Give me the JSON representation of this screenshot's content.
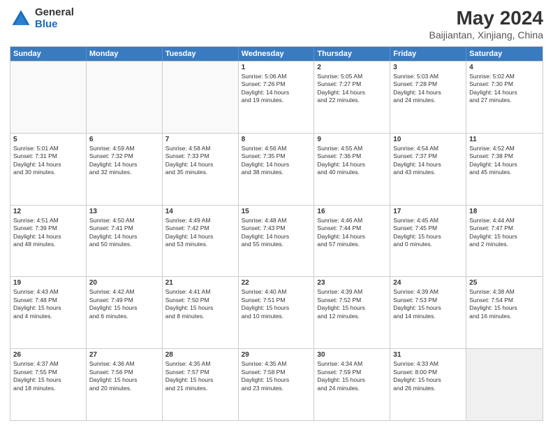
{
  "logo": {
    "general": "General",
    "blue": "Blue"
  },
  "title": "May 2024",
  "subtitle": "Baijiantan, Xinjiang, China",
  "header_days": [
    "Sunday",
    "Monday",
    "Tuesday",
    "Wednesday",
    "Thursday",
    "Friday",
    "Saturday"
  ],
  "rows": [
    [
      {
        "day": "",
        "lines": [],
        "empty": true
      },
      {
        "day": "",
        "lines": [],
        "empty": true
      },
      {
        "day": "",
        "lines": [],
        "empty": true
      },
      {
        "day": "1",
        "lines": [
          "Sunrise: 5:06 AM",
          "Sunset: 7:26 PM",
          "Daylight: 14 hours",
          "and 19 minutes."
        ]
      },
      {
        "day": "2",
        "lines": [
          "Sunrise: 5:05 AM",
          "Sunset: 7:27 PM",
          "Daylight: 14 hours",
          "and 22 minutes."
        ]
      },
      {
        "day": "3",
        "lines": [
          "Sunrise: 5:03 AM",
          "Sunset: 7:28 PM",
          "Daylight: 14 hours",
          "and 24 minutes."
        ]
      },
      {
        "day": "4",
        "lines": [
          "Sunrise: 5:02 AM",
          "Sunset: 7:30 PM",
          "Daylight: 14 hours",
          "and 27 minutes."
        ]
      }
    ],
    [
      {
        "day": "5",
        "lines": [
          "Sunrise: 5:01 AM",
          "Sunset: 7:31 PM",
          "Daylight: 14 hours",
          "and 30 minutes."
        ]
      },
      {
        "day": "6",
        "lines": [
          "Sunrise: 4:59 AM",
          "Sunset: 7:32 PM",
          "Daylight: 14 hours",
          "and 32 minutes."
        ]
      },
      {
        "day": "7",
        "lines": [
          "Sunrise: 4:58 AM",
          "Sunset: 7:33 PM",
          "Daylight: 14 hours",
          "and 35 minutes."
        ]
      },
      {
        "day": "8",
        "lines": [
          "Sunrise: 4:56 AM",
          "Sunset: 7:35 PM",
          "Daylight: 14 hours",
          "and 38 minutes."
        ]
      },
      {
        "day": "9",
        "lines": [
          "Sunrise: 4:55 AM",
          "Sunset: 7:36 PM",
          "Daylight: 14 hours",
          "and 40 minutes."
        ]
      },
      {
        "day": "10",
        "lines": [
          "Sunrise: 4:54 AM",
          "Sunset: 7:37 PM",
          "Daylight: 14 hours",
          "and 43 minutes."
        ]
      },
      {
        "day": "11",
        "lines": [
          "Sunrise: 4:52 AM",
          "Sunset: 7:38 PM",
          "Daylight: 14 hours",
          "and 45 minutes."
        ]
      }
    ],
    [
      {
        "day": "12",
        "lines": [
          "Sunrise: 4:51 AM",
          "Sunset: 7:39 PM",
          "Daylight: 14 hours",
          "and 48 minutes."
        ]
      },
      {
        "day": "13",
        "lines": [
          "Sunrise: 4:50 AM",
          "Sunset: 7:41 PM",
          "Daylight: 14 hours",
          "and 50 minutes."
        ]
      },
      {
        "day": "14",
        "lines": [
          "Sunrise: 4:49 AM",
          "Sunset: 7:42 PM",
          "Daylight: 14 hours",
          "and 53 minutes."
        ]
      },
      {
        "day": "15",
        "lines": [
          "Sunrise: 4:48 AM",
          "Sunset: 7:43 PM",
          "Daylight: 14 hours",
          "and 55 minutes."
        ]
      },
      {
        "day": "16",
        "lines": [
          "Sunrise: 4:46 AM",
          "Sunset: 7:44 PM",
          "Daylight: 14 hours",
          "and 57 minutes."
        ]
      },
      {
        "day": "17",
        "lines": [
          "Sunrise: 4:45 AM",
          "Sunset: 7:45 PM",
          "Daylight: 15 hours",
          "and 0 minutes."
        ]
      },
      {
        "day": "18",
        "lines": [
          "Sunrise: 4:44 AM",
          "Sunset: 7:47 PM",
          "Daylight: 15 hours",
          "and 2 minutes."
        ]
      }
    ],
    [
      {
        "day": "19",
        "lines": [
          "Sunrise: 4:43 AM",
          "Sunset: 7:48 PM",
          "Daylight: 15 hours",
          "and 4 minutes."
        ]
      },
      {
        "day": "20",
        "lines": [
          "Sunrise: 4:42 AM",
          "Sunset: 7:49 PM",
          "Daylight: 15 hours",
          "and 6 minutes."
        ]
      },
      {
        "day": "21",
        "lines": [
          "Sunrise: 4:41 AM",
          "Sunset: 7:50 PM",
          "Daylight: 15 hours",
          "and 8 minutes."
        ]
      },
      {
        "day": "22",
        "lines": [
          "Sunrise: 4:40 AM",
          "Sunset: 7:51 PM",
          "Daylight: 15 hours",
          "and 10 minutes."
        ]
      },
      {
        "day": "23",
        "lines": [
          "Sunrise: 4:39 AM",
          "Sunset: 7:52 PM",
          "Daylight: 15 hours",
          "and 12 minutes."
        ]
      },
      {
        "day": "24",
        "lines": [
          "Sunrise: 4:39 AM",
          "Sunset: 7:53 PM",
          "Daylight: 15 hours",
          "and 14 minutes."
        ]
      },
      {
        "day": "25",
        "lines": [
          "Sunrise: 4:38 AM",
          "Sunset: 7:54 PM",
          "Daylight: 15 hours",
          "and 16 minutes."
        ]
      }
    ],
    [
      {
        "day": "26",
        "lines": [
          "Sunrise: 4:37 AM",
          "Sunset: 7:55 PM",
          "Daylight: 15 hours",
          "and 18 minutes."
        ]
      },
      {
        "day": "27",
        "lines": [
          "Sunrise: 4:36 AM",
          "Sunset: 7:56 PM",
          "Daylight: 15 hours",
          "and 20 minutes."
        ]
      },
      {
        "day": "28",
        "lines": [
          "Sunrise: 4:35 AM",
          "Sunset: 7:57 PM",
          "Daylight: 15 hours",
          "and 21 minutes."
        ]
      },
      {
        "day": "29",
        "lines": [
          "Sunrise: 4:35 AM",
          "Sunset: 7:58 PM",
          "Daylight: 15 hours",
          "and 23 minutes."
        ]
      },
      {
        "day": "30",
        "lines": [
          "Sunrise: 4:34 AM",
          "Sunset: 7:59 PM",
          "Daylight: 15 hours",
          "and 24 minutes."
        ]
      },
      {
        "day": "31",
        "lines": [
          "Sunrise: 4:33 AM",
          "Sunset: 8:00 PM",
          "Daylight: 15 hours",
          "and 26 minutes."
        ]
      },
      {
        "day": "",
        "lines": [],
        "empty": true,
        "shaded": true
      }
    ]
  ]
}
